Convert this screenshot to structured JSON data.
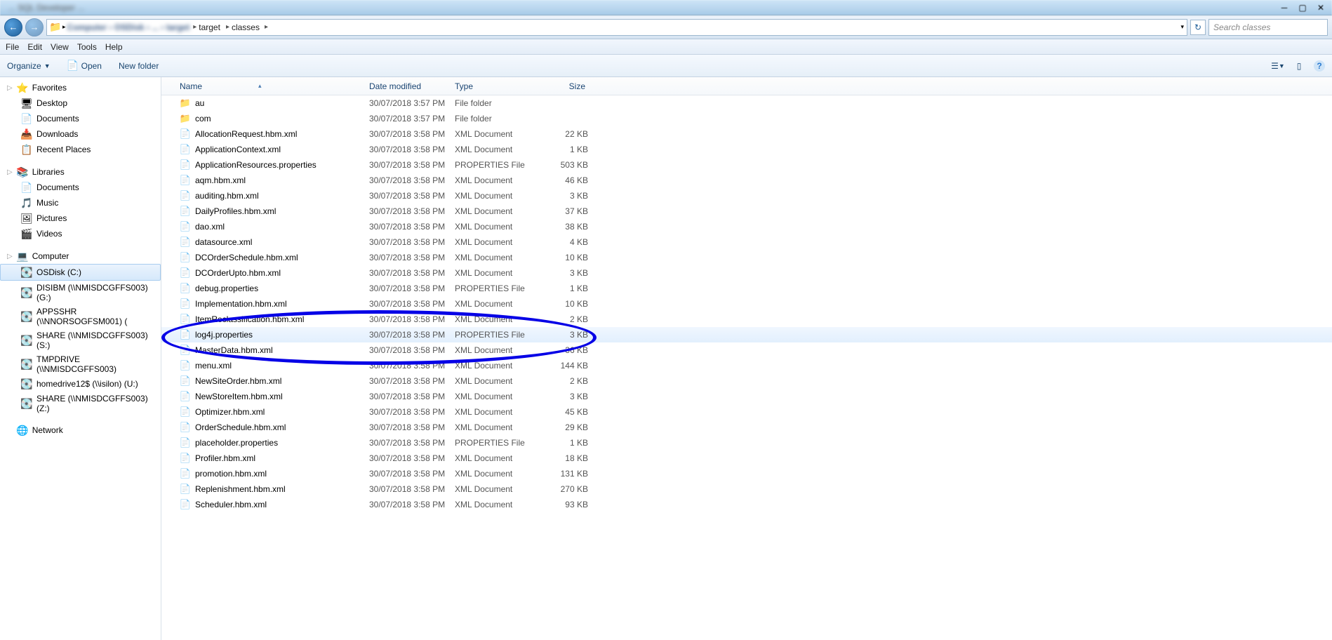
{
  "title_bar": {
    "left": "... SQL Developer ... "
  },
  "breadcrumb": {
    "blurred_path": "Computer › OSDisk › ... › target",
    "items": [
      "target",
      "classes"
    ]
  },
  "search": {
    "placeholder": "Search classes"
  },
  "menu": [
    "File",
    "Edit",
    "View",
    "Tools",
    "Help"
  ],
  "toolbar": {
    "organize": "Organize",
    "open": "Open",
    "new_folder": "New folder"
  },
  "sidebar": {
    "favorites": {
      "label": "Favorites",
      "items": [
        "Desktop",
        "Documents",
        "Downloads",
        "Recent Places"
      ]
    },
    "libraries": {
      "label": "Libraries",
      "items": [
        "Documents",
        "Music",
        "Pictures",
        "Videos"
      ]
    },
    "computer": {
      "label": "Computer",
      "items": [
        "OSDisk (C:)",
        "DISIBM (\\\\NMISDCGFFS003) (G:)",
        "APPSSHR (\\\\NNORSOGFSM001) (",
        "SHARE (\\\\NMISDCGFFS003) (S:)",
        "TMPDRIVE (\\\\NMISDCGFFS003)",
        "homedrive12$ (\\\\isilon) (U:)",
        "SHARE (\\\\NMISDCGFFS003) (Z:)"
      ]
    },
    "network": {
      "label": "Network"
    }
  },
  "columns": {
    "name": "Name",
    "date": "Date modified",
    "type": "Type",
    "size": "Size"
  },
  "files": [
    {
      "name": "au",
      "date": "30/07/2018 3:57 PM",
      "type": "File folder",
      "size": "",
      "icon": "folder"
    },
    {
      "name": "com",
      "date": "30/07/2018 3:57 PM",
      "type": "File folder",
      "size": "",
      "icon": "folder"
    },
    {
      "name": "AllocationRequest.hbm.xml",
      "date": "30/07/2018 3:58 PM",
      "type": "XML Document",
      "size": "22 KB",
      "icon": "xml"
    },
    {
      "name": "ApplicationContext.xml",
      "date": "30/07/2018 3:58 PM",
      "type": "XML Document",
      "size": "1 KB",
      "icon": "xml"
    },
    {
      "name": "ApplicationResources.properties",
      "date": "30/07/2018 3:58 PM",
      "type": "PROPERTIES File",
      "size": "503 KB",
      "icon": "file"
    },
    {
      "name": "aqm.hbm.xml",
      "date": "30/07/2018 3:58 PM",
      "type": "XML Document",
      "size": "46 KB",
      "icon": "xml"
    },
    {
      "name": "auditing.hbm.xml",
      "date": "30/07/2018 3:58 PM",
      "type": "XML Document",
      "size": "3 KB",
      "icon": "xml"
    },
    {
      "name": "DailyProfiles.hbm.xml",
      "date": "30/07/2018 3:58 PM",
      "type": "XML Document",
      "size": "37 KB",
      "icon": "xml"
    },
    {
      "name": "dao.xml",
      "date": "30/07/2018 3:58 PM",
      "type": "XML Document",
      "size": "38 KB",
      "icon": "xml"
    },
    {
      "name": "datasource.xml",
      "date": "30/07/2018 3:58 PM",
      "type": "XML Document",
      "size": "4 KB",
      "icon": "xml"
    },
    {
      "name": "DCOrderSchedule.hbm.xml",
      "date": "30/07/2018 3:58 PM",
      "type": "XML Document",
      "size": "10 KB",
      "icon": "xml"
    },
    {
      "name": "DCOrderUpto.hbm.xml",
      "date": "30/07/2018 3:58 PM",
      "type": "XML Document",
      "size": "3 KB",
      "icon": "xml"
    },
    {
      "name": "debug.properties",
      "date": "30/07/2018 3:58 PM",
      "type": "PROPERTIES File",
      "size": "1 KB",
      "icon": "file"
    },
    {
      "name": "Implementation.hbm.xml",
      "date": "30/07/2018 3:58 PM",
      "type": "XML Document",
      "size": "10 KB",
      "icon": "xml"
    },
    {
      "name": "ItemReclassification.hbm.xml",
      "date": "30/07/2018 3:58 PM",
      "type": "XML Document",
      "size": "2 KB",
      "icon": "xml"
    },
    {
      "name": "log4j.properties",
      "date": "30/07/2018 3:58 PM",
      "type": "PROPERTIES File",
      "size": "3 KB",
      "icon": "file",
      "selected": true
    },
    {
      "name": "MasterData.hbm.xml",
      "date": "30/07/2018 3:58 PM",
      "type": "XML Document",
      "size": "36 KB",
      "icon": "xml"
    },
    {
      "name": "menu.xml",
      "date": "30/07/2018 3:58 PM",
      "type": "XML Document",
      "size": "144 KB",
      "icon": "xml"
    },
    {
      "name": "NewSiteOrder.hbm.xml",
      "date": "30/07/2018 3:58 PM",
      "type": "XML Document",
      "size": "2 KB",
      "icon": "xml"
    },
    {
      "name": "NewStoreItem.hbm.xml",
      "date": "30/07/2018 3:58 PM",
      "type": "XML Document",
      "size": "3 KB",
      "icon": "xml"
    },
    {
      "name": "Optimizer.hbm.xml",
      "date": "30/07/2018 3:58 PM",
      "type": "XML Document",
      "size": "45 KB",
      "icon": "xml"
    },
    {
      "name": "OrderSchedule.hbm.xml",
      "date": "30/07/2018 3:58 PM",
      "type": "XML Document",
      "size": "29 KB",
      "icon": "xml"
    },
    {
      "name": "placeholder.properties",
      "date": "30/07/2018 3:58 PM",
      "type": "PROPERTIES File",
      "size": "1 KB",
      "icon": "file"
    },
    {
      "name": "Profiler.hbm.xml",
      "date": "30/07/2018 3:58 PM",
      "type": "XML Document",
      "size": "18 KB",
      "icon": "xml"
    },
    {
      "name": "promotion.hbm.xml",
      "date": "30/07/2018 3:58 PM",
      "type": "XML Document",
      "size": "131 KB",
      "icon": "xml"
    },
    {
      "name": "Replenishment.hbm.xml",
      "date": "30/07/2018 3:58 PM",
      "type": "XML Document",
      "size": "270 KB",
      "icon": "xml"
    },
    {
      "name": "Scheduler.hbm.xml",
      "date": "30/07/2018 3:58 PM",
      "type": "XML Document",
      "size": "93 KB",
      "icon": "xml"
    }
  ],
  "icons": {
    "folder": "📁",
    "xml": "📄",
    "file": "📄",
    "desktop": "🖥",
    "docs": "📄",
    "downloads": "📥",
    "recent": "📋",
    "music": "🎵",
    "pictures": "🖼",
    "videos": "🎬",
    "drive": "💽",
    "net": "🌐",
    "lib": "📚",
    "star": "⭐",
    "comp": "💻"
  }
}
